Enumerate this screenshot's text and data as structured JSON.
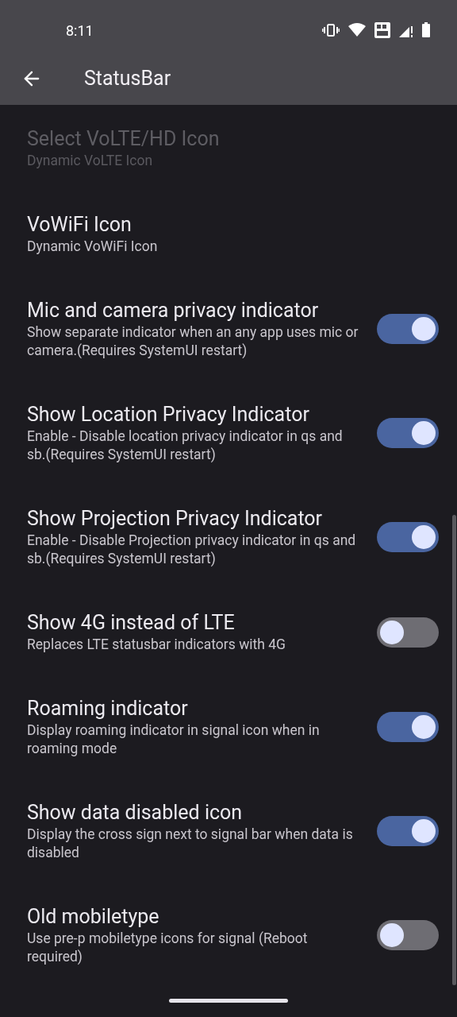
{
  "status_bar": {
    "time": "8:11"
  },
  "app_bar": {
    "title": "StatusBar"
  },
  "settings": [
    {
      "kind": "plain",
      "title": "Select VoLTE/HD Icon",
      "summary": "Dynamic VoLTE Icon",
      "disabled": true
    },
    {
      "kind": "plain",
      "title": "VoWiFi Icon",
      "summary": "Dynamic VoWiFi Icon",
      "disabled": false
    },
    {
      "kind": "switch",
      "title": "Mic and camera privacy indicator",
      "summary": "Show separate indicator when an any app uses mic or camera.(Requires SystemUI restart)",
      "on": true
    },
    {
      "kind": "switch",
      "title": "Show Location Privacy Indicator",
      "summary": "Enable - Disable location privacy indicator in qs and sb.(Requires SystemUI restart)",
      "on": true
    },
    {
      "kind": "switch",
      "title": "Show Projection Privacy Indicator",
      "summary": "Enable - Disable Projection privacy indicator in qs and sb.(Requires SystemUI restart)",
      "on": true
    },
    {
      "kind": "switch",
      "title": "Show 4G instead of LTE",
      "summary": "Replaces LTE statusbar indicators with 4G",
      "on": false
    },
    {
      "kind": "switch",
      "title": "Roaming indicator",
      "summary": "Display roaming indicator in signal icon when in roaming mode",
      "on": true
    },
    {
      "kind": "switch",
      "title": "Show data disabled icon",
      "summary": "Display the cross sign next to signal bar when data is disabled",
      "on": true
    },
    {
      "kind": "switch",
      "title": "Old mobiletype",
      "summary": "Use pre-p mobiletype icons for signal (Reboot required)",
      "on": false
    }
  ]
}
